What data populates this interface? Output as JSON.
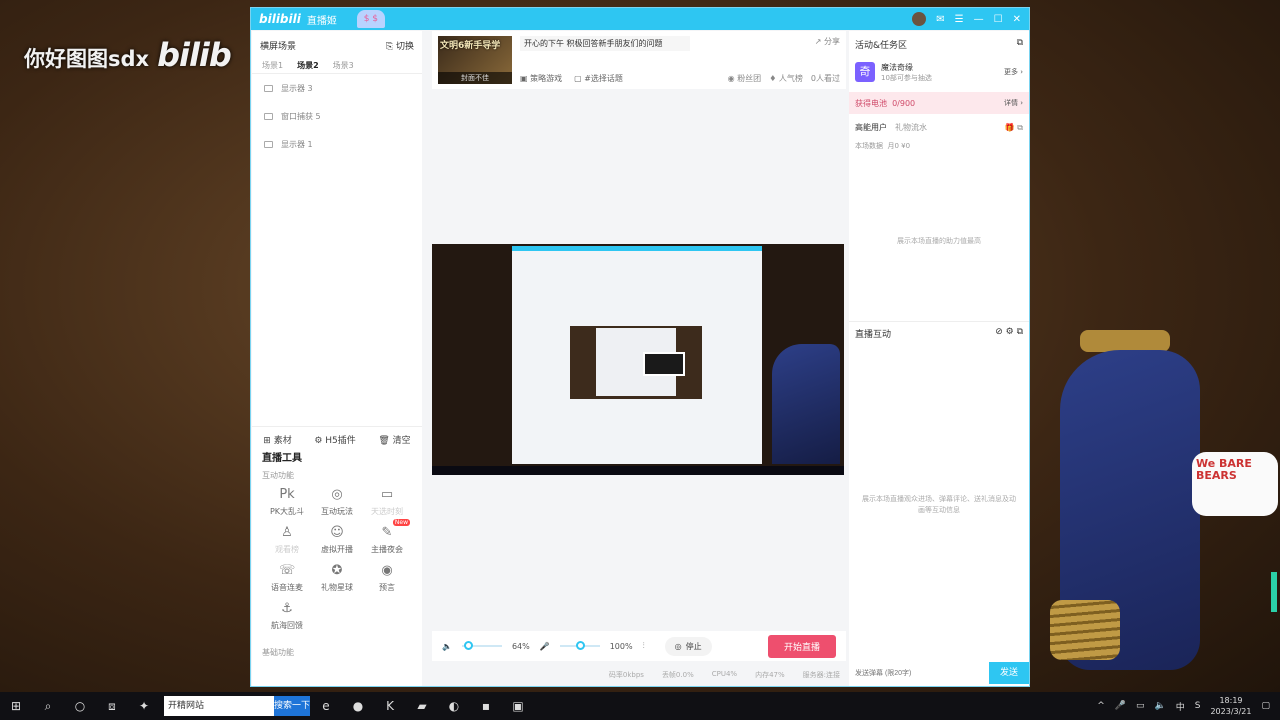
{
  "watermark": {
    "text": "你好图图sdx",
    "logo": "bilib"
  },
  "badge": {
    "line1": "We BARE",
    "line2": "BEARS"
  },
  "window": {
    "app_name": "bilibili",
    "title": "直播姬",
    "mascot": "$ $"
  },
  "scenes": {
    "header": "横屏场景",
    "switch": "切换",
    "tabs": [
      "场景1",
      "场景2",
      "场景3"
    ],
    "items": [
      "显示器 3",
      "窗口捕获 5",
      "显示器 1"
    ]
  },
  "resources": {
    "material": "素材",
    "h5": "H5插件",
    "clear": "清空"
  },
  "tools": {
    "title": "直播工具",
    "interactive": "互动功能",
    "items": [
      {
        "label": "PK大乱斗",
        "icon": "Pk"
      },
      {
        "label": "互动玩法",
        "icon": "◎"
      },
      {
        "label": "天选时刻",
        "icon": "▭"
      },
      {
        "label": "观看榜",
        "icon": "♙"
      },
      {
        "label": "虚拟开播",
        "icon": "☺"
      },
      {
        "label": "主播夜会",
        "icon": "✎",
        "badge": "New"
      },
      {
        "label": "语音连麦",
        "icon": "☏"
      },
      {
        "label": "礼物星球",
        "icon": "✪"
      },
      {
        "label": "预言",
        "icon": "◉"
      },
      {
        "label": "航海回馈",
        "icon": "⚓"
      }
    ],
    "basic": "基础功能"
  },
  "room": {
    "cover_title": "文明6新手导学",
    "cover_bottom": "封面不佳",
    "title": "开心的下午 积极回答新手朋友们的问题",
    "category": "策略游戏",
    "topic": "#选择话题",
    "share": "分享",
    "fans": "粉丝团",
    "popularity": "人气榜",
    "viewers": "0人看过"
  },
  "controls": {
    "volume": "64%",
    "volume_level": 0.64,
    "mic": "100%",
    "mic_level": 1.0,
    "stop": "停止",
    "start": "开始直播"
  },
  "stats": [
    "码率0kbps",
    "丢帧0.0%",
    "CPU4%",
    "内存47%",
    "服务器:连接"
  ],
  "right": {
    "activity_title": "活动&任务区",
    "activity_name": "魔法奇缘",
    "activity_sub": "10部可参与抽选",
    "more": "更多",
    "battery_label": "获得电池",
    "battery_value": "0/900",
    "detail": "详情",
    "high_energy": "高能用户",
    "gift_stream": "礼物流水",
    "scene_data": "本场数据",
    "scene_values": "月0  ¥0",
    "empty_support": "展示本场直播的助力值最高",
    "interaction": "直播互动",
    "empty_interaction": "展示本场直播观众进场、弹幕评论、送礼消息及动画等互动信息",
    "input_placeholder": "发送弹幕 (限20字)",
    "send": "发送"
  },
  "taskbar": {
    "search_text": "开精网站",
    "search_btn": "搜索一下",
    "ime": "中",
    "time": "18:19",
    "date": "2023/3/21"
  },
  "colors": {
    "accent": "#2ec6f2",
    "start_button": "#ee4f6e"
  }
}
